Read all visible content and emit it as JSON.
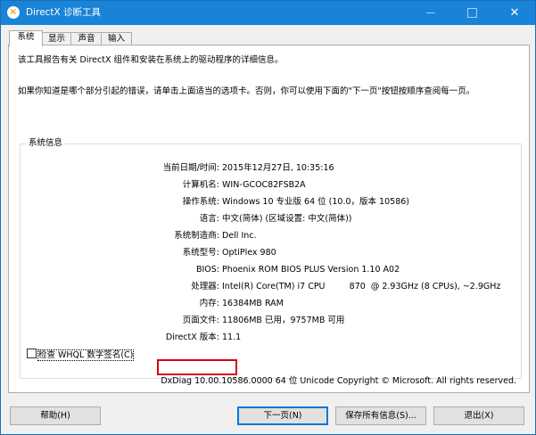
{
  "window": {
    "title": "DirectX 诊断工具"
  },
  "tabs": [
    {
      "label": "系统"
    },
    {
      "label": "显示"
    },
    {
      "label": "声音"
    },
    {
      "label": "输入"
    }
  ],
  "intro": {
    "line1": "该工具报告有关 DirectX 组件和安装在系统上的驱动程序的详细信息。",
    "line2": "如果你知道是哪个部分引起的错误，请单击上面适当的选项卡。否则，你可以使用下面的\"下一页\"按钮按顺序查阅每一页。"
  },
  "system_info": {
    "group_title": "系统信息",
    "rows": [
      {
        "label": "当前日期/时间:",
        "value": "2015年12月27日, 10:35:16"
      },
      {
        "label": "计算机名:",
        "value": "WIN-GCOC82FSB2A"
      },
      {
        "label": "操作系统:",
        "value": "Windows 10 专业版 64 位 (10.0，版本 10586)"
      },
      {
        "label": "语言:",
        "value": "中文(简体) (区域设置: 中文(简体))"
      },
      {
        "label": "系统制造商:",
        "value": "Dell Inc."
      },
      {
        "label": "系统型号:",
        "value": "OptiPlex 980"
      },
      {
        "label": "BIOS:",
        "value": "Phoenix ROM BIOS PLUS Version 1.10 A02"
      },
      {
        "label": "处理器:",
        "value": "Intel(R) Core(TM) i7 CPU         870  @ 2.93GHz (8 CPUs), ~2.9GHz"
      },
      {
        "label": "内存:",
        "value": "16384MB RAM"
      },
      {
        "label": "页面文件:",
        "value": "11806MB 已用，9757MB 可用"
      },
      {
        "label": "DirectX 版本:",
        "value": "11.1"
      }
    ]
  },
  "whql": {
    "label": "检查 WHQL 数字签名(C)",
    "checked": false
  },
  "footer_text": "DxDiag 10.00.10586.0000 64 位 Unicode  Copyright © Microsoft. All rights reserved.",
  "buttons": {
    "help": "帮助(H)",
    "next": "下一页(N)",
    "save": "保存所有信息(S)...",
    "exit": "退出(X)"
  },
  "colors": {
    "titlebar": "#1883d7",
    "highlight_border": "#d6001a"
  }
}
